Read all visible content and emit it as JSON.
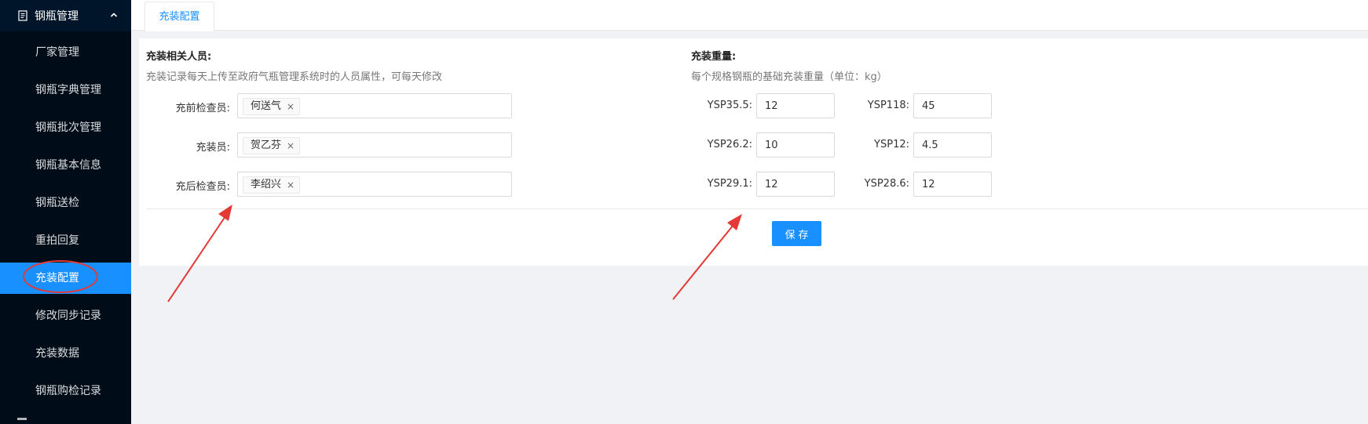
{
  "sidebar": {
    "section_title": "钢瓶管理",
    "section_icon": "file-list-icon",
    "items": [
      {
        "label": "厂家管理"
      },
      {
        "label": "钢瓶字典管理"
      },
      {
        "label": "钢瓶批次管理"
      },
      {
        "label": "钢瓶基本信息"
      },
      {
        "label": "钢瓶送检"
      },
      {
        "label": "重拍回复"
      },
      {
        "label": "充装配置"
      },
      {
        "label": "修改同步记录"
      },
      {
        "label": "充装数据"
      },
      {
        "label": "钢瓶购检记录"
      }
    ],
    "active_index": 6
  },
  "tabs": [
    {
      "label": "充装配置"
    }
  ],
  "personnel": {
    "title": "充装相关人员:",
    "description": "充装记录每天上传至政府气瓶管理系统时的人员属性，可每天修改",
    "fields": [
      {
        "label": "充前检查员:",
        "tag": "何送气"
      },
      {
        "label": "充装员:",
        "tag": "贺乙芬"
      },
      {
        "label": "充后检查员:",
        "tag": "李绍兴"
      }
    ],
    "tag_remove_glyph": "×"
  },
  "weights": {
    "title": "充装重量:",
    "description": "每个规格钢瓶的基础充装重量（单位：kg）",
    "fields": [
      {
        "label": "YSP35.5:",
        "value": "12"
      },
      {
        "label": "YSP118:",
        "value": "45"
      },
      {
        "label": "YSP26.2:",
        "value": "10"
      },
      {
        "label": "YSP12:",
        "value": "4.5"
      },
      {
        "label": "YSP29.1:",
        "value": "12"
      },
      {
        "label": "YSP28.6:",
        "value": "12"
      }
    ]
  },
  "actions": {
    "save_label": "保存"
  },
  "colors": {
    "sidebar_bg": "#001529",
    "submenu_bg": "#000c17",
    "accent": "#1890ff",
    "annotation": "#e53935"
  }
}
